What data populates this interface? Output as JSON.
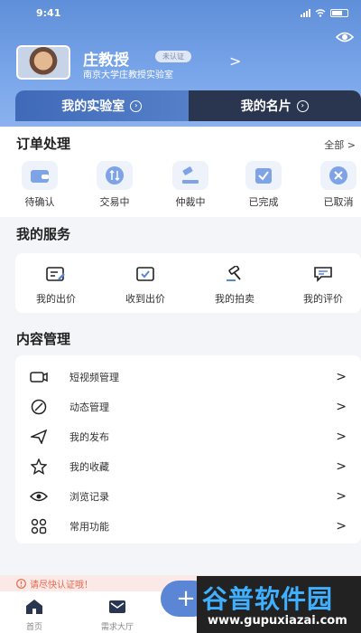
{
  "status_bar": {
    "time": "9:41"
  },
  "profile": {
    "name": "庄教授",
    "badge": "未认证",
    "subtitle": "南京大学庄教授实验室",
    "arrow": ">"
  },
  "tabs": [
    {
      "label": "我的实验室"
    },
    {
      "label": "我的名片"
    }
  ],
  "orders": {
    "title": "订单处理",
    "all_label": "全部 >",
    "items": [
      {
        "label": "待确认",
        "icon": "wallet-icon"
      },
      {
        "label": "交易中",
        "icon": "exchange-icon"
      },
      {
        "label": "仲裁中",
        "icon": "gavel-icon"
      },
      {
        "label": "已完成",
        "icon": "check-box-icon"
      },
      {
        "label": "已取消",
        "icon": "cancel-icon"
      }
    ]
  },
  "services": {
    "title": "我的服务",
    "items": [
      {
        "label": "我的出价",
        "icon": "edit-card-icon"
      },
      {
        "label": "收到出价",
        "icon": "check-card-icon"
      },
      {
        "label": "我的拍卖",
        "icon": "hammer-icon"
      },
      {
        "label": "我的评价",
        "icon": "comment-icon"
      }
    ]
  },
  "content": {
    "title": "内容管理",
    "items": [
      {
        "label": "短视频管理",
        "icon": "video-icon",
        "arrow": ">"
      },
      {
        "label": "动态管理",
        "icon": "compass-icon",
        "arrow": ">"
      },
      {
        "label": "我的发布",
        "icon": "send-icon",
        "arrow": ">"
      },
      {
        "label": "我的收藏",
        "icon": "star-icon",
        "arrow": ">"
      },
      {
        "label": "浏览记录",
        "icon": "eye-icon",
        "arrow": ">"
      },
      {
        "label": "常用功能",
        "icon": "grid-icon",
        "arrow": ">"
      }
    ]
  },
  "notice": {
    "text": "请尽快认证哦！"
  },
  "bottom_nav": {
    "items": [
      {
        "label": "首页",
        "icon": "home-icon"
      },
      {
        "label": "需求大厅",
        "icon": "mail-icon"
      }
    ],
    "plus": "+"
  },
  "watermark": {
    "main": "谷普软件园",
    "url": "www.gupuxiazai.com"
  },
  "colors": {
    "primary": "#5b86d6",
    "dark_tab": "#2a3550",
    "notice": "#e66a4e"
  }
}
